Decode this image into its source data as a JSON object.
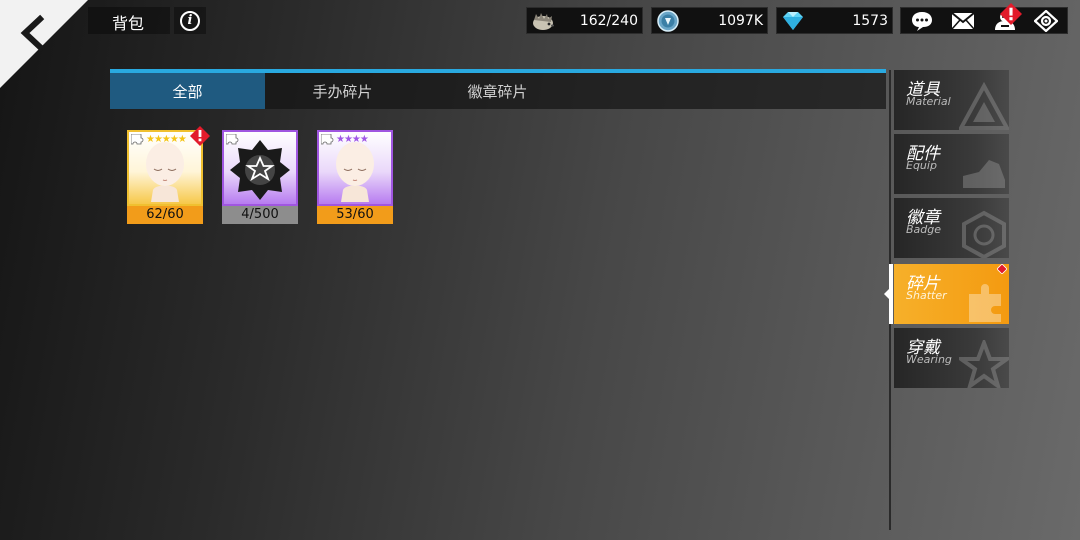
{
  "header": {
    "title": "背包",
    "info_icon": "info-icon"
  },
  "resources": {
    "stamina": {
      "value": "162/240",
      "icon": "hedgehog-stamina-icon"
    },
    "coin": {
      "value": "1097K",
      "icon": "coin-icon"
    },
    "gem": {
      "value": "1573",
      "icon": "diamond-icon"
    }
  },
  "toolbar_icons": [
    "chat-icon",
    "mail-icon",
    "friends-icon",
    "settings-icon"
  ],
  "tabs": [
    {
      "label": "全部",
      "active": true
    },
    {
      "label": "手办碎片",
      "active": false
    },
    {
      "label": "徽章碎片",
      "active": false
    }
  ],
  "items": [
    {
      "count": "62/60",
      "rarity": "gold",
      "stars": "★★★★★",
      "type": "figure-shard",
      "alert": true
    },
    {
      "count": "4/500",
      "rarity": "purple",
      "stars": "",
      "type": "badge-shard",
      "alert": false
    },
    {
      "count": "53/60",
      "rarity": "purple",
      "stars": "★★★★",
      "type": "figure-shard",
      "alert": false
    }
  ],
  "categories": [
    {
      "cn": "道具",
      "en": "Material",
      "active": false
    },
    {
      "cn": "配件",
      "en": "Equip",
      "active": false
    },
    {
      "cn": "徽章",
      "en": "Badge",
      "active": false
    },
    {
      "cn": "碎片",
      "en": "Shatter",
      "active": true
    },
    {
      "cn": "穿戴",
      "en": "Wearing",
      "active": false
    }
  ],
  "colors": {
    "accent_blue": "#29a9e0",
    "active_tab": "#1f5a80",
    "active_category": "#f49a10",
    "gold_rarity": "#f0c030",
    "purple_rarity": "#a056e0",
    "alert_red": "#e21b2b"
  }
}
